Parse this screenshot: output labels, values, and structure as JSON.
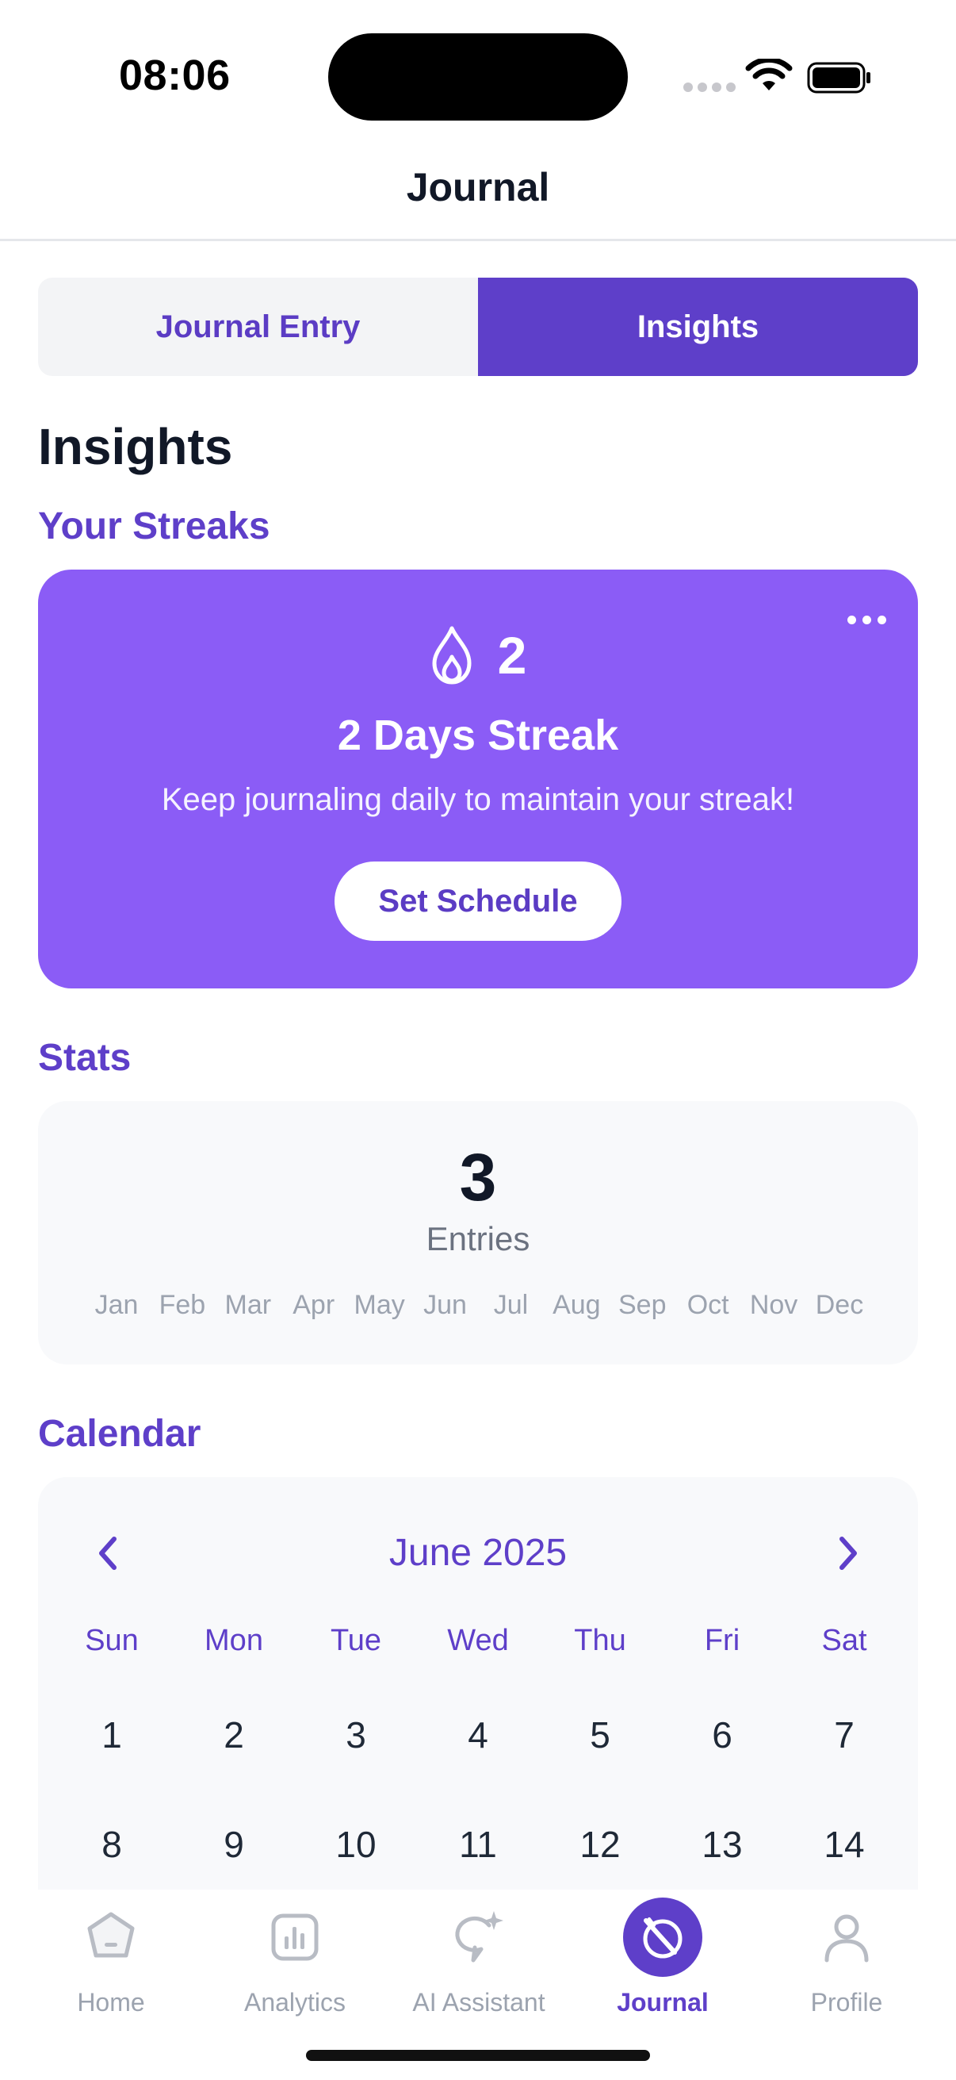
{
  "status_bar": {
    "time": "08:06"
  },
  "header": {
    "title": "Journal"
  },
  "segments": {
    "entry": "Journal Entry",
    "insights": "Insights"
  },
  "page": {
    "title": "Insights"
  },
  "streaks": {
    "section_title": "Your Streaks",
    "count": "2",
    "title": "2 Days Streak",
    "subtitle": "Keep journaling daily to maintain your streak!",
    "button": "Set Schedule"
  },
  "stats": {
    "section_title": "Stats",
    "entries_count": "3",
    "entries_label": "Entries",
    "months": [
      "Jan",
      "Feb",
      "Mar",
      "Apr",
      "May",
      "Jun",
      "Jul",
      "Aug",
      "Sep",
      "Oct",
      "Nov",
      "Dec"
    ]
  },
  "calendar": {
    "section_title": "Calendar",
    "month_label": "June 2025",
    "weekdays": [
      "Sun",
      "Mon",
      "Tue",
      "Wed",
      "Thu",
      "Fri",
      "Sat"
    ],
    "days": [
      "1",
      "2",
      "3",
      "4",
      "5",
      "6",
      "7",
      "8",
      "9",
      "10",
      "11",
      "12",
      "13",
      "14"
    ]
  },
  "tab_bar": {
    "home": "Home",
    "analytics": "Analytics",
    "ai_assistant": "AI Assistant",
    "journal": "Journal",
    "profile": "Profile"
  },
  "colors": {
    "accent": "#5e3fc9",
    "streak_card": "#8b5cf6",
    "muted": "#9ca3af"
  }
}
